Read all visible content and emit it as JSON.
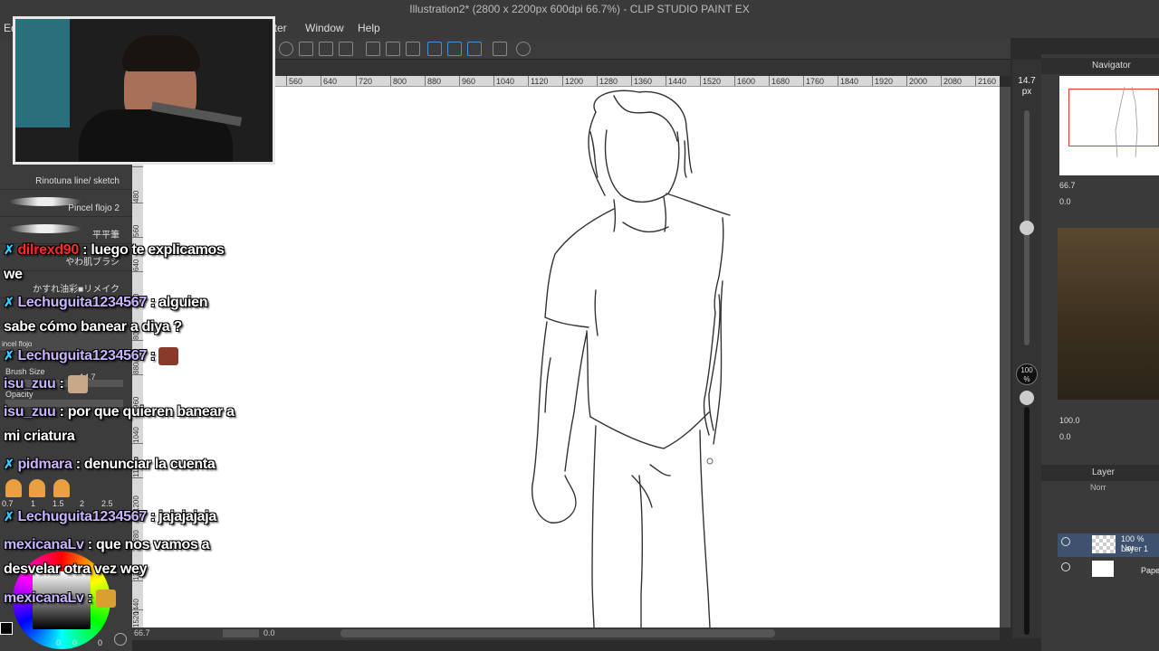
{
  "window": {
    "title": "Illustration2* (2800 x 2200px 600dpi 66.7%)  - CLIP STUDIO PAINT EX"
  },
  "menu": {
    "items": [
      "Ed",
      "lter",
      "Window",
      "Help"
    ]
  },
  "ruler_top": {
    "ticks": [
      "560",
      "640",
      "720",
      "800",
      "880",
      "960",
      "1040",
      "1120",
      "1200",
      "1280",
      "1360",
      "1440",
      "1520",
      "1600",
      "1680",
      "1760",
      "1840",
      "1920",
      "2000",
      "2080",
      "2160"
    ]
  },
  "ruler_left": {
    "ticks": [
      "480",
      "560",
      "640",
      "720",
      "800",
      "880",
      "960",
      "1040",
      "1120",
      "1200",
      "1280",
      "1360",
      "1440",
      "1520"
    ]
  },
  "brushes": {
    "items": [
      {
        "label": "Rinotuna line/ sketch"
      },
      {
        "label": "Pincel flojo 2"
      },
      {
        "label": "平平筆"
      },
      {
        "label": "やわ肌ブラシ"
      },
      {
        "label": "かすれ油彩■リメイク"
      },
      {
        "label": "incel flojo"
      }
    ],
    "brush_size_label": "Brush Size",
    "brush_size_value": "14.7",
    "opacity_label": "Opacity",
    "size_presets": [
      "0.7",
      "1",
      "1.5",
      "2",
      "2.5"
    ],
    "color_values": [
      "0",
      "0",
      "0"
    ]
  },
  "slider": {
    "size_value": "14.7",
    "size_unit": "px",
    "opacity_value": "100",
    "opacity_unit": "%"
  },
  "bottom": {
    "zoom": "66.7",
    "angle": "0.0"
  },
  "navigator": {
    "title": "Navigator",
    "zoom": "66.7",
    "angle": "0.0"
  },
  "subview": {
    "zoom": "100.0",
    "angle": "0.0"
  },
  "layers": {
    "title": "Layer",
    "blend_mode": "Norr",
    "items": [
      {
        "opacity_mode": "100 % Nor",
        "name": "Layer 1"
      },
      {
        "name": "Pape"
      }
    ]
  },
  "chat": [
    {
      "user": "dilrexd90",
      "user_color": "#ff2a2a",
      "text": ": luego te explicamos",
      "cont": "we"
    },
    {
      "user": "Lechuguita1234567",
      "text": ": alguien",
      "cont": "sabe cómo banear a diya ?"
    },
    {
      "user": "Lechuguita1234567",
      "text": ":",
      "emote": "face-emote"
    },
    {
      "user": "isu_zuu",
      "text": ":",
      "emote": "hamster-emote"
    },
    {
      "user": "isu_zuu",
      "text": ": por que quieren banear a",
      "cont": "mi criatura"
    },
    {
      "user": "pidmara",
      "text": ": denunciar la cuenta",
      "emote_row": "people-emotes"
    },
    {
      "user": "Lechuguita1234567",
      "text": ": jajajajaja"
    },
    {
      "user": "mexicanaLv",
      "text": ": que nos vamos a",
      "cont": "desvelar otra vez wey"
    },
    {
      "user": "mexicanaLv",
      "text": ":",
      "emote": "cat-emote"
    }
  ],
  "colors": {
    "chat_user": "#c9b4ff",
    "highlight_user": "#ff2a2a",
    "badge": "#3ec8ff",
    "ui_bg": "#3a3a3a",
    "canvas": "#ffffff",
    "accent_blue": "#4a8fd8"
  }
}
